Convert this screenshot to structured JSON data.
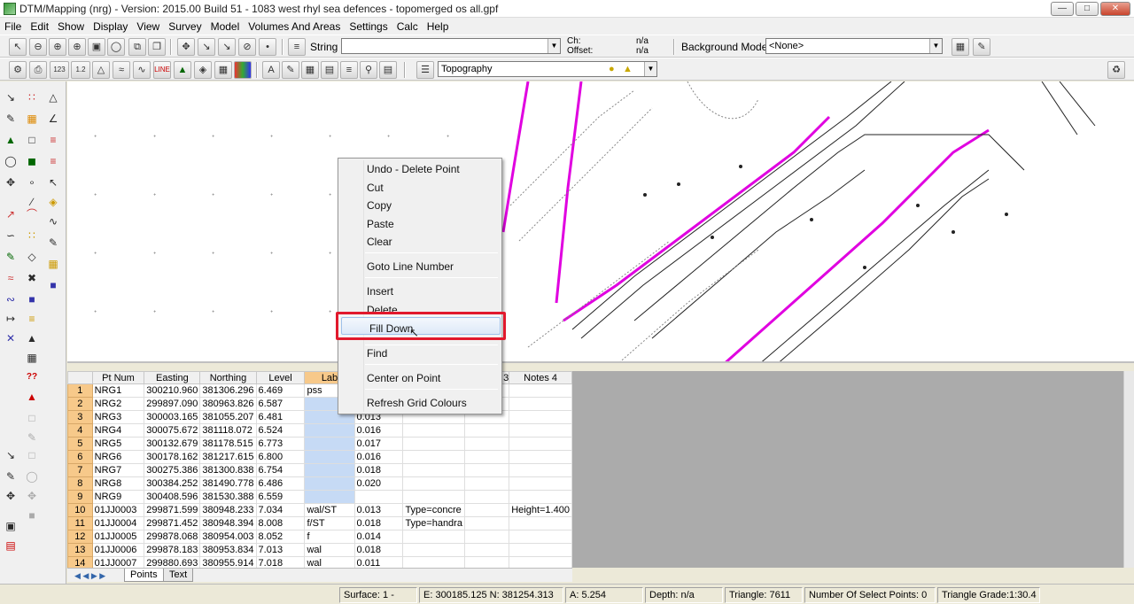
{
  "window": {
    "title": "DTM/Mapping (nrg) - Version: 2015.00 Build 51 - 1083 west rhyl sea defences - topomerged os all.gpf"
  },
  "menu": [
    "File",
    "Edit",
    "Show",
    "Display",
    "View",
    "Survey",
    "Model",
    "Volumes And Areas",
    "Settings",
    "Calc",
    "Help"
  ],
  "toolbar1": {
    "string_label": "String",
    "string_value": "",
    "ch_label": "Ch:",
    "offset_label": "Offset:",
    "ch_value": "n/a",
    "offset_value": "n/a",
    "background_label": "Background Model:",
    "background_value": "<None>"
  },
  "toolbar2": {
    "layer_value": "Topography"
  },
  "grid": {
    "columns": [
      "Pt Num",
      "Easting",
      "Northing",
      "Level",
      "Lab",
      "3",
      "Notes 4"
    ],
    "rows": [
      {
        "n": "1",
        "pt": "NRG1",
        "e": "300210.960",
        "no": "381306.296",
        "lv": "6.469",
        "lab": "pss",
        "c6": "",
        "c7": "",
        "c8": "",
        "c9": ""
      },
      {
        "n": "2",
        "pt": "NRG2",
        "e": "299897.090",
        "no": "380963.826",
        "lv": "6.587",
        "lab": "",
        "c6": "",
        "c7": "",
        "c8": "",
        "c9": ""
      },
      {
        "n": "3",
        "pt": "NRG3",
        "e": "300003.165",
        "no": "381055.207",
        "lv": "6.481",
        "lab": "",
        "c6": "0.013",
        "c7": "",
        "c8": "",
        "c9": ""
      },
      {
        "n": "4",
        "pt": "NRG4",
        "e": "300075.672",
        "no": "381118.072",
        "lv": "6.524",
        "lab": "",
        "c6": "0.016",
        "c7": "",
        "c8": "",
        "c9": ""
      },
      {
        "n": "5",
        "pt": "NRG5",
        "e": "300132.679",
        "no": "381178.515",
        "lv": "6.773",
        "lab": "",
        "c6": "0.017",
        "c7": "",
        "c8": "",
        "c9": ""
      },
      {
        "n": "6",
        "pt": "NRG6",
        "e": "300178.162",
        "no": "381217.615",
        "lv": "6.800",
        "lab": "",
        "c6": "0.016",
        "c7": "",
        "c8": "",
        "c9": ""
      },
      {
        "n": "7",
        "pt": "NRG7",
        "e": "300275.386",
        "no": "381300.838",
        "lv": "6.754",
        "lab": "",
        "c6": "0.018",
        "c7": "",
        "c8": "",
        "c9": ""
      },
      {
        "n": "8",
        "pt": "NRG8",
        "e": "300384.252",
        "no": "381490.778",
        "lv": "6.486",
        "lab": "",
        "c6": "0.020",
        "c7": "",
        "c8": "",
        "c9": ""
      },
      {
        "n": "9",
        "pt": "NRG9",
        "e": "300408.596",
        "no": "381530.388",
        "lv": "6.559",
        "lab": "",
        "c6": "",
        "c7": "",
        "c8": "",
        "c9": ""
      },
      {
        "n": "10",
        "pt": "01JJ0003",
        "e": "299871.599",
        "no": "380948.233",
        "lv": "7.034",
        "lab": "wal/ST",
        "c6": "0.013",
        "c7": "Type=concre",
        "c8": "",
        "c9": "Height=1.400"
      },
      {
        "n": "11",
        "pt": "01JJ0004",
        "e": "299871.452",
        "no": "380948.394",
        "lv": "8.008",
        "lab": "f/ST",
        "c6": "0.018",
        "c7": "Type=handra",
        "c8": "",
        "c9": ""
      },
      {
        "n": "12",
        "pt": "01JJ0005",
        "e": "299878.068",
        "no": "380954.003",
        "lv": "8.052",
        "lab": "f",
        "c6": "0.014",
        "c7": "",
        "c8": "",
        "c9": ""
      },
      {
        "n": "13",
        "pt": "01JJ0006",
        "e": "299878.183",
        "no": "380953.834",
        "lv": "7.013",
        "lab": "wal",
        "c6": "0.018",
        "c7": "",
        "c8": "",
        "c9": ""
      },
      {
        "n": "14",
        "pt": "01JJ0007",
        "e": "299880.693",
        "no": "380955.914",
        "lv": "7.018",
        "lab": "wal",
        "c6": "0.011",
        "c7": "",
        "c8": "",
        "c9": ""
      }
    ]
  },
  "sheet_tabs": [
    "Points",
    "Text"
  ],
  "context_menu": {
    "items": [
      "Undo - Delete Point",
      "Cut",
      "Copy",
      "Paste",
      "Clear",
      "Goto Line Number",
      "Insert",
      "Delete",
      "Fill Down",
      "Find",
      "Center on Point",
      "Refresh Grid Colours"
    ],
    "highlighted": "Fill Down"
  },
  "status": {
    "surface": "Surface: 1 -",
    "coords": "E: 300185.125  N: 381254.313",
    "angle": "A: 5.254",
    "depth": "Depth: n/a",
    "triangle": "Triangle: 7611",
    "selected": "Number Of Select Points: 0",
    "grade": "Triangle Grade:1:30.4"
  },
  "colors": {
    "highlight": "#e1192d",
    "magenta_line": "#e000e0",
    "row_number": "#f7c98a"
  }
}
